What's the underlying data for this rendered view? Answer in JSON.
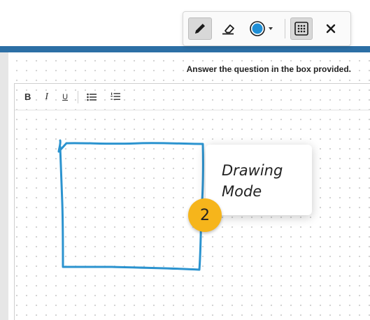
{
  "prompt": {
    "text": "Answer the question in the box provided."
  },
  "editor_toolbar": {
    "bold": "B",
    "italic": "I",
    "underline": "U",
    "bulleted_list_icon": "bulleted-list-icon",
    "numbered_list_icon": "numbered-list-icon"
  },
  "drawing_toolbar": {
    "pen_icon": "pencil-icon",
    "eraser_icon": "eraser-icon",
    "color_icon": "color-swatch-icon",
    "grid_icon": "grid-icon",
    "close_icon": "close-icon",
    "selected_tool": "pen",
    "pen_color": "#1f8fd6"
  },
  "callout": {
    "text": "Drawing\nMode",
    "step": "2"
  },
  "drawing": {
    "stroke_color": "#2b93cf",
    "shape": "hand-drawn square"
  },
  "colors": {
    "accent_bar": "#2c6fa5",
    "badge": "#f6b51b"
  }
}
